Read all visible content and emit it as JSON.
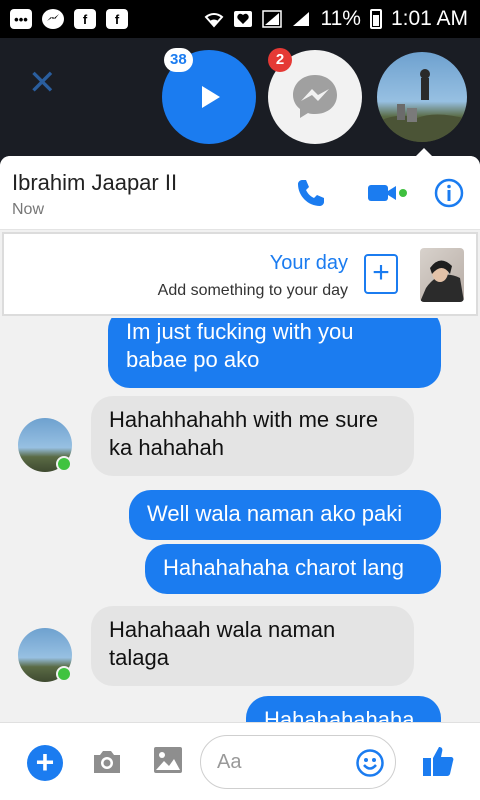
{
  "status_bar": {
    "battery_text": "11%",
    "time": "1:01 AM",
    "left_icons": [
      "chat-dots-icon",
      "messenger-icon",
      "facebook-icon",
      "facebook-icon"
    ],
    "right_icons": [
      "wifi-icon",
      "heart-icon",
      "signal-icon",
      "signal-icon",
      "battery-icon"
    ]
  },
  "chat_heads": {
    "video_badge": "38",
    "messenger_badge": "2"
  },
  "conversation": {
    "contact_name": "Ibrahim Jaapar II",
    "contact_status": "Now",
    "accent_color": "#1b7cf0"
  },
  "your_day": {
    "title": "Your day",
    "subtitle": "Add something to your day"
  },
  "messages": [
    {
      "direction": "out",
      "text_line1": "Im just fucking with you",
      "text_line2": "babae po ako"
    },
    {
      "direction": "in",
      "text_line1": "Hahahhahahh with me sure",
      "text_line2": "ka hahahah"
    },
    {
      "direction": "out",
      "text": "Well wala naman ako paki"
    },
    {
      "direction": "out",
      "text": "Hahahahaha charot lang"
    },
    {
      "direction": "in",
      "text_line1": "Hahahaah wala naman",
      "text_line2": "talaga"
    },
    {
      "direction": "out",
      "text": "Hahahahahaha"
    }
  ],
  "composer": {
    "placeholder": "Aa"
  }
}
